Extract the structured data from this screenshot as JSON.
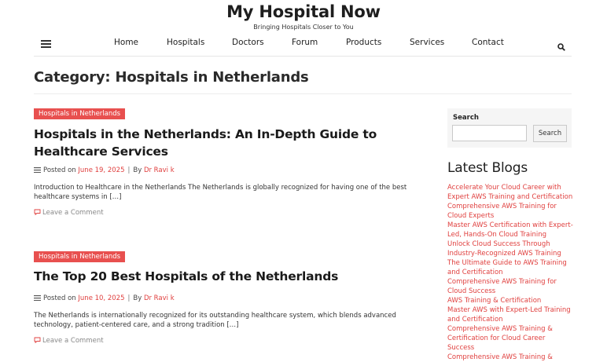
{
  "site": {
    "title": "My Hospital Now",
    "tagline": "Bringing Hospitals Closer to You"
  },
  "nav": {
    "menu_icon": "hamburger-icon",
    "items": [
      "Home",
      "Hospitals",
      "Doctors",
      "Forum",
      "Products",
      "Services",
      "Contact"
    ],
    "search_icon": "search-icon"
  },
  "category_title": "Category: Hospitals in Netherlands",
  "posts": [
    {
      "category": "Hospitals in Netherlands",
      "title": "Hospitals in the Netherlands: An In-Depth Guide to Healthcare Services",
      "posted_on_label": "Posted on",
      "date": "June 19, 2025",
      "by_label": "By",
      "author": "Dr Ravi k",
      "excerpt": "Introduction to Healthcare in the Netherlands The Netherlands is globally recognized for having one of the best healthcare systems in […]",
      "comment_label": "Leave a Comment"
    },
    {
      "category": "Hospitals in Netherlands",
      "title": "The Top 20 Best Hospitals of the Netherlands",
      "posted_on_label": "Posted on",
      "date": "June 10, 2025",
      "by_label": "By",
      "author": "Dr Ravi k",
      "excerpt": "The Netherlands is internationally recognized for its outstanding healthcare system, which blends advanced technology, patient-centered care, and a strong tradition […]",
      "comment_label": "Leave a Comment"
    }
  ],
  "sidebar": {
    "search_label": "Search",
    "search_placeholder": "",
    "search_button": "Search",
    "latest_title": "Latest Blogs",
    "blogs": [
      "Accelerate Your Cloud Career with Expert AWS Training and Certification",
      "Comprehensive AWS Training for Cloud Experts",
      "Master AWS Certification with Expert-Led, Hands-On Cloud Training",
      "Unlock Cloud Success Through Industry-Recognized AWS Training",
      "The Ultimate Guide to AWS Training and Certification",
      "Comprehensive AWS Training for Cloud Success",
      "AWS Training & Certification",
      "Master AWS with Expert-Led Training and Certification",
      "Comprehensive AWS Training & Certification for Cloud Career Success",
      "Comprehensive AWS Training &"
    ]
  },
  "colors": {
    "accent": "#e8504f",
    "link": "#e0403f"
  }
}
